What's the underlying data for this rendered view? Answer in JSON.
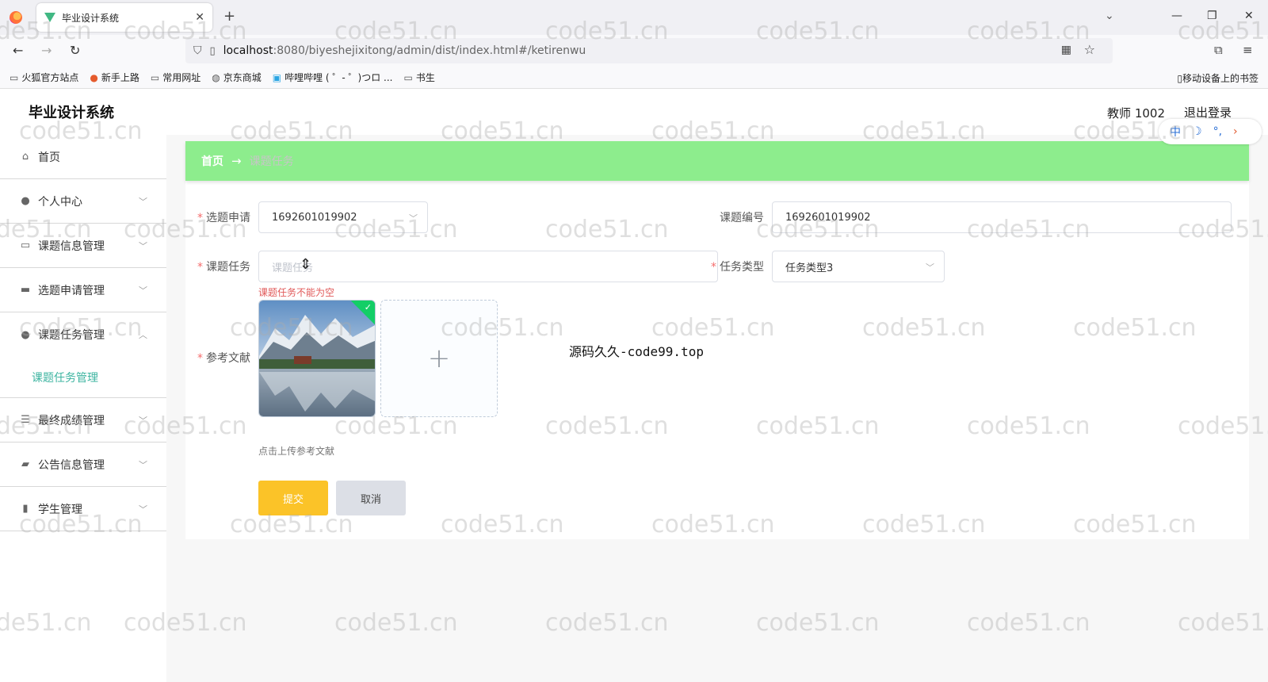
{
  "browser": {
    "tab_title": "毕业设计系统",
    "url_host": "localhost",
    "url_path": ":8080/biyeshejixitong/admin/dist/index.html#/ketirenwu",
    "bookmarks": [
      {
        "label": "火狐官方站点",
        "icon": "folder-icon"
      },
      {
        "label": "新手上路",
        "icon": "firefox-icon"
      },
      {
        "label": "常用网址",
        "icon": "folder-icon"
      },
      {
        "label": "京东商城",
        "icon": "globe-icon"
      },
      {
        "label": "哔哩哔哩 ( ゜- ゜)つロ ...",
        "icon": "bilibili-icon"
      },
      {
        "label": "书生",
        "icon": "folder-icon"
      }
    ],
    "mobile_bookmarks": "移动设备上的书签"
  },
  "header": {
    "system_title": "毕业设计系统",
    "user": "教师 1002",
    "logout": "退出登录"
  },
  "sidebar": {
    "items": [
      {
        "label": "首页",
        "icon": "home-icon"
      },
      {
        "label": "个人中心",
        "icon": "user-icon"
      },
      {
        "label": "课题信息管理",
        "icon": "message-icon"
      },
      {
        "label": "选题申请管理",
        "icon": "monitor-icon"
      },
      {
        "label": "课题任务管理",
        "icon": "user-icon"
      },
      {
        "label": "最终成绩管理",
        "icon": "list-icon"
      },
      {
        "label": "公告信息管理",
        "icon": "ticket-icon"
      },
      {
        "label": "学生管理",
        "icon": "chart-icon"
      }
    ],
    "submenu": "课题任务管理"
  },
  "breadcrumb": {
    "home": "首页",
    "arrow": "→",
    "current": "课题任务"
  },
  "form": {
    "application_label": "选题申请",
    "application_value": "1692601019902",
    "topic_no_label": "课题编号",
    "topic_no_value": "1692601019902",
    "task_label": "课题任务",
    "task_placeholder": "课题任务",
    "task_error": "课题任务不能为空",
    "type_label": "任务类型",
    "type_value": "任务类型3",
    "reference_label": "参考文献",
    "upload_tip": "点击上传参考文献",
    "submit": "提交",
    "cancel": "取消",
    "required_mark": "*"
  },
  "overlay_text": "源码久久-code99.top",
  "ime": {
    "mode": "中",
    "moon": "☽",
    "punct": "°,",
    "arrow": "›"
  },
  "watermark": "code51.cn",
  "colors": {
    "breadcrumb_bg": "#8ded8d",
    "submit": "#fbc328",
    "active_submenu": "#3cb4a0",
    "error": "#e15a5a"
  }
}
